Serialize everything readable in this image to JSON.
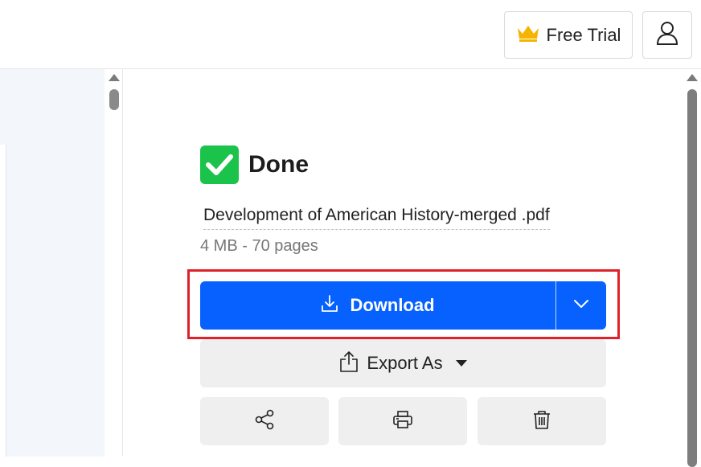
{
  "header": {
    "free_trial_label": "Free Trial",
    "crown_icon": "crown-icon",
    "user_icon": "user-icon"
  },
  "result": {
    "status_label": "Done",
    "file_name": "Development of American History-merged .pdf",
    "file_info": "4 MB - 70 pages"
  },
  "actions": {
    "download_label": "Download",
    "export_label": "Export As",
    "share_icon": "share-icon",
    "print_icon": "print-icon",
    "delete_icon": "trash-icon"
  },
  "colors": {
    "accent": "#0661ff",
    "success": "#1cc34b",
    "highlight": "#e0202a",
    "crown": "#f5b400"
  }
}
